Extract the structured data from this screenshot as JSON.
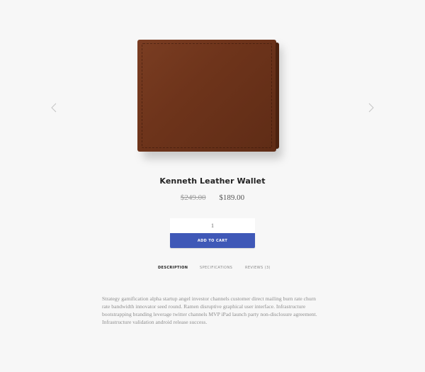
{
  "product": {
    "title": "Kenneth Leather Wallet",
    "old_price": "$249.00",
    "new_price": "$189.00",
    "image_icon": "wallet-image"
  },
  "cart": {
    "quantity": "1",
    "add_label": "ADD TO CART",
    "button_color": "#3f58b7"
  },
  "gallery": {
    "prev_icon": "chevron-left-icon",
    "next_icon": "chevron-right-icon"
  },
  "tabs": [
    {
      "label": "DESCRIPTION",
      "active": true
    },
    {
      "label": "SPECIFICATIONS",
      "active": false
    },
    {
      "label": "REVIEWS (3)",
      "active": false
    }
  ],
  "description": "Strategy gamification alpha startup angel investor channels customer direct mailing burn rate churn rate bandwidth innovator seed round. Ramen disruptive graphical user interface. Infrastructure bootstrapping branding leverage twitter channels MVP iPad launch party non-disclosure agreement. Infrastructure validation android release success."
}
